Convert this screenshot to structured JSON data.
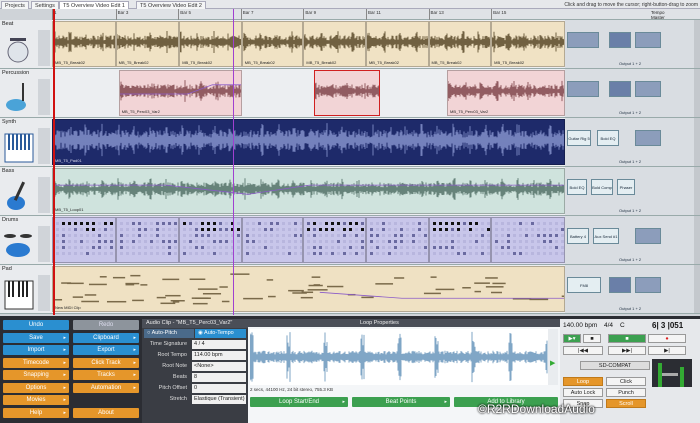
{
  "tabs": [
    "Projects",
    "Settings",
    "T5 Overview Video Edit 1",
    "T5 Overview Video Edit 2"
  ],
  "active_tab": 2,
  "hint": "Click and drag to move the cursor; right-button-drag to zoom",
  "tempo_labels": [
    "Tempo",
    "Master"
  ],
  "ruler": {
    "bar_labels": [
      {
        "text": "1",
        "pos": 0
      },
      {
        "text": "Bar 3",
        "pos": 0.124
      },
      {
        "text": "Bar 5",
        "pos": 0.246
      },
      {
        "text": "Bar 7",
        "pos": 0.368
      },
      {
        "text": "Bar 9",
        "pos": 0.49
      },
      {
        "text": "Bar 11",
        "pos": 0.612
      },
      {
        "text": "Bar 13",
        "pos": 0.734
      },
      {
        "text": "Bar 15",
        "pos": 0.856
      }
    ]
  },
  "tracks": [
    {
      "name": "Beat",
      "icon": "drum-kit-icon",
      "color": "#f0e2c4",
      "wave": "#3a2a0a",
      "clips": [
        {
          "label": "MB_T5_Break02",
          "start": 0.0,
          "end": 0.124
        },
        {
          "label": "MB_T5_Break02",
          "start": 0.124,
          "end": 0.248
        },
        {
          "label": "MB_T5_Break02",
          "start": 0.248,
          "end": 0.37
        },
        {
          "label": "MB_T5_Break02",
          "start": 0.37,
          "end": 0.49
        },
        {
          "label": "MB_T5_Break02",
          "start": 0.49,
          "end": 0.612
        },
        {
          "label": "MB_T5_Break02",
          "start": 0.612,
          "end": 0.734
        },
        {
          "label": "MB_T5_Break02",
          "start": 0.734,
          "end": 0.856
        },
        {
          "label": "MB_T5_Break02",
          "start": 0.856,
          "end": 1.0
        }
      ],
      "plugins": [
        {
          "label": "",
          "x": 2,
          "w": 32
        },
        {
          "label": "",
          "x": 44,
          "w": 22
        },
        {
          "label": "",
          "x": 70,
          "w": 26
        }
      ],
      "output": "Output 1 + 2"
    },
    {
      "name": "Percussion",
      "icon": "percussion-icon",
      "color": "#f2d4d6",
      "wave": "#6a2a30",
      "clips": [
        {
          "label": "MB_T5_Perc03_Var2",
          "start": 0.13,
          "end": 0.37
        },
        {
          "label": "",
          "start": 0.51,
          "end": 0.64
        },
        {
          "label": "MB_T5_Perc03_Var2",
          "start": 0.77,
          "end": 1.0
        }
      ],
      "plugins": [
        {
          "label": "",
          "x": 2,
          "w": 32
        },
        {
          "label": "",
          "x": 44,
          "w": 22
        },
        {
          "label": "",
          "x": 70,
          "w": 26
        }
      ],
      "output": "Output 1 + 2"
    },
    {
      "name": "Synth",
      "icon": "keyboard-icon",
      "color": "#1e2a6a",
      "wave": "#9aa8e0",
      "clips": [
        {
          "label": "MB_T5_Pad01",
          "start": 0.0,
          "end": 1.0
        }
      ],
      "plugins": [
        {
          "label": "Guitar Rig 5 RFX",
          "x": 2,
          "w": 24
        },
        {
          "label": "Bold EQ",
          "x": 32,
          "w": 22
        },
        {
          "label": "",
          "x": 70,
          "w": 26
        }
      ],
      "output": "Output 1 + 2"
    },
    {
      "name": "Bass",
      "icon": "bass-guitar-icon",
      "color": "#cfe3dd",
      "wave": "#3a5a50",
      "clips": [
        {
          "label": "MB_T5_Loop01",
          "start": 0.0,
          "end": 1.0
        }
      ],
      "plugins": [
        {
          "label": "Bold EQ",
          "x": 2,
          "w": 20
        },
        {
          "label": "Bold Comp",
          "x": 26,
          "w": 22
        },
        {
          "label": "Phaser",
          "x": 52,
          "w": 18
        }
      ],
      "output": "Output 1 + 2"
    },
    {
      "name": "Drums",
      "icon": "drums-icon",
      "color": "#c8c6ea",
      "wave": "#3a3a6a",
      "clips": [
        {
          "label": "",
          "start": 0.0,
          "end": 0.124
        },
        {
          "label": "",
          "start": 0.124,
          "end": 0.248
        },
        {
          "label": "",
          "start": 0.248,
          "end": 0.37
        },
        {
          "label": "",
          "start": 0.37,
          "end": 0.49
        },
        {
          "label": "",
          "start": 0.49,
          "end": 0.612
        },
        {
          "label": "",
          "start": 0.612,
          "end": 0.734
        },
        {
          "label": "",
          "start": 0.734,
          "end": 0.856
        },
        {
          "label": "",
          "start": 0.856,
          "end": 1.0
        }
      ],
      "plugins": [
        {
          "label": "Battery 4",
          "x": 2,
          "w": 22
        },
        {
          "label": "Aux Send #1",
          "x": 28,
          "w": 26
        },
        {
          "label": "",
          "x": 70,
          "w": 26
        }
      ],
      "output": "Output 1 + 2"
    },
    {
      "name": "Pad",
      "icon": "piano-icon",
      "color": "#efe1c3",
      "wave": "#7a6a4a",
      "clips": [
        {
          "label": "New MIDI Clip",
          "start": 0.0,
          "end": 1.0
        }
      ],
      "plugins": [
        {
          "label": "FM8",
          "x": 2,
          "w": 34
        },
        {
          "label": "",
          "x": 44,
          "w": 22
        },
        {
          "label": "",
          "x": 70,
          "w": 26
        }
      ],
      "output": "Output 1 + 2"
    }
  ],
  "left_buttons": [
    [
      "Undo",
      "Redo"
    ],
    [
      "Save",
      "Clipboard"
    ],
    [
      "Import",
      "Export"
    ],
    [
      "Timecode",
      "Click Track"
    ],
    [
      "Snapping",
      "Tracks"
    ],
    [
      "Options",
      "Automation"
    ],
    [
      "Movies",
      ""
    ],
    [
      "Help",
      "About"
    ]
  ],
  "clip_panel": {
    "header": "Audio Clip - \"MB_T5_Perc03_Var2\"",
    "auto_pitch": "Auto-Pitch",
    "auto_tempo": "Auto-Tempo",
    "rows": [
      {
        "label": "Time Signature",
        "value": "4    /    4"
      },
      {
        "label": "Root Tempo",
        "value": "114.00 bpm"
      },
      {
        "label": "Root Note",
        "value": "<None>"
      },
      {
        "label": "Beats",
        "value": "8"
      },
      {
        "label": "Pitch Offset",
        "value": "0"
      },
      {
        "label": "Stretch",
        "value": "Elastique (Transient)"
      }
    ]
  },
  "loop_panel": {
    "header": "Loop Properties",
    "info": "2 secs, 44100 Hz, 24 bit stereo, 755.3 KB",
    "buttons": [
      "Loop Start/End",
      "Beat Points",
      "Add to Library"
    ]
  },
  "transport": {
    "tempo": "140.00 bpm",
    "sig": "4/4",
    "key": "C",
    "position": "6| 3 |051",
    "mode": "SD-COMPAT",
    "buttons": [
      "Loop",
      "Click",
      "Auto Lock",
      "Punch",
      "Snap",
      "Scroll"
    ]
  },
  "watermark": "©R2RDownloadAudio"
}
